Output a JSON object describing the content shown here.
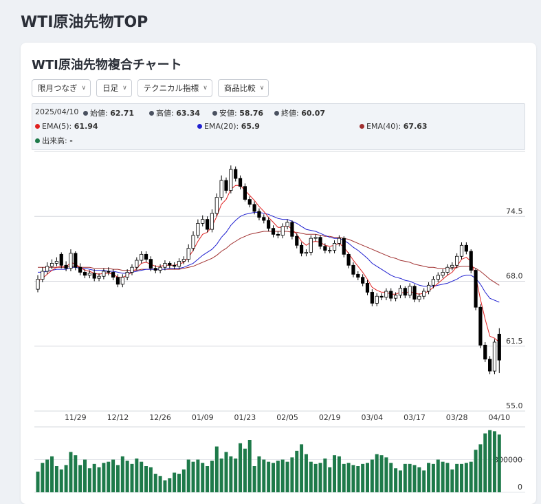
{
  "page": {
    "title": "WTI原油先物TOP"
  },
  "card": {
    "title": "WTI原油先物複合チャート"
  },
  "controls": [
    {
      "label": "限月つなぎ"
    },
    {
      "label": "日足"
    },
    {
      "label": "テクニカル指標"
    },
    {
      "label": "商品比較"
    }
  ],
  "info": {
    "date": "2025/04/10",
    "open_label": "始値:",
    "open": "62.71",
    "high_label": "高値:",
    "high": "63.34",
    "low_label": "安値:",
    "low": "58.76",
    "close_label": "終値:",
    "close": "60.07",
    "ema5_label": "EMA(5):",
    "ema5": "61.94",
    "ema20_label": "EMA(20):",
    "ema20": "65.9",
    "ema40_label": "EMA(40):",
    "ema40": "67.63",
    "volume_label": "出来高:",
    "volume": "-"
  },
  "colors": {
    "up": "#ffffff",
    "down": "#000000",
    "ema5": "#e02020",
    "ema20": "#2020d0",
    "ema40": "#a03030",
    "volume": "#1e7a4a",
    "ohlc_dot": "#4a5160"
  },
  "chart_data": {
    "type": "candlestick",
    "price_axis": {
      "ticks": [
        55.0,
        61.5,
        68.0,
        74.5
      ],
      "tick_labels": [
        "55.0",
        "61.5",
        "68.0",
        "74.5"
      ],
      "range": [
        55.0,
        81.0
      ]
    },
    "volume_axis": {
      "ticks": [
        0,
        300000
      ],
      "tick_labels": [
        "0",
        "300000"
      ],
      "range": [
        0,
        600000
      ]
    },
    "x_tick_labels": [
      "11/29",
      "12/12",
      "12/26",
      "01/09",
      "01/23",
      "02/05",
      "02/19",
      "03/04",
      "03/17",
      "03/28",
      "04/10"
    ],
    "x_tick_index": [
      8,
      17,
      26,
      35,
      44,
      53,
      62,
      71,
      80,
      89,
      98
    ],
    "series": [
      {
        "name": "EMA(5)"
      },
      {
        "name": "EMA(20)"
      },
      {
        "name": "EMA(40)"
      }
    ],
    "closes": [
      68.2,
      69.0,
      69.5,
      69.8,
      70.0,
      69.6,
      69.3,
      70.8,
      69.4,
      68.9,
      68.6,
      68.8,
      68.3,
      68.5,
      69.0,
      68.9,
      68.4,
      67.7,
      68.4,
      68.9,
      69.4,
      70.1,
      70.7,
      70.2,
      69.3,
      69.1,
      69.4,
      69.8,
      69.6,
      69.5,
      70.0,
      70.2,
      71.3,
      72.6,
      73.8,
      74.2,
      73.2,
      74.8,
      76.4,
      78.1,
      77.1,
      79.2,
      78.3,
      77.5,
      76.2,
      75.7,
      75.0,
      74.4,
      74.1,
      73.3,
      72.7,
      72.6,
      73.5,
      73.9,
      72.5,
      71.6,
      70.8,
      70.9,
      72.3,
      72.4,
      71.5,
      71.1,
      71.1,
      71.8,
      72.3,
      70.7,
      69.6,
      68.7,
      68.4,
      67.8,
      66.9,
      65.8,
      66.5,
      66.4,
      67.0,
      66.3,
      66.6,
      67.3,
      66.6,
      67.5,
      66.2,
      66.5,
      67.0,
      67.6,
      68.2,
      68.6,
      68.9,
      69.4,
      69.6,
      70.5,
      71.6,
      71.0,
      69.1,
      65.4,
      61.6,
      60.2,
      59.0,
      61.9,
      60.1
    ],
    "opens": [
      67.2,
      68.2,
      69.0,
      69.5,
      69.8,
      70.7,
      69.6,
      69.3,
      70.8,
      69.4,
      68.9,
      68.6,
      68.8,
      68.3,
      68.5,
      69.0,
      68.9,
      68.4,
      67.7,
      68.4,
      68.9,
      69.4,
      70.1,
      70.7,
      70.2,
      69.3,
      69.1,
      69.4,
      69.8,
      69.6,
      69.5,
      70.0,
      70.2,
      71.3,
      72.6,
      73.8,
      74.2,
      73.2,
      74.8,
      76.4,
      78.1,
      77.1,
      79.2,
      78.3,
      77.5,
      76.2,
      75.7,
      75.0,
      74.4,
      74.1,
      73.3,
      72.7,
      72.6,
      73.5,
      73.9,
      72.5,
      71.6,
      70.8,
      70.9,
      72.3,
      72.4,
      71.5,
      71.1,
      71.1,
      71.8,
      72.3,
      70.7,
      69.6,
      68.7,
      68.4,
      67.8,
      66.9,
      65.8,
      66.5,
      66.4,
      67.0,
      66.3,
      66.6,
      67.3,
      66.6,
      67.5,
      66.2,
      66.5,
      67.0,
      67.6,
      68.2,
      68.6,
      68.9,
      69.4,
      69.6,
      70.5,
      71.6,
      71.0,
      69.1,
      65.4,
      61.6,
      60.2,
      59.0,
      62.7
    ],
    "highs": [
      68.6,
      69.4,
      69.9,
      70.2,
      70.4,
      70.9,
      70.0,
      71.2,
      71.0,
      69.8,
      69.2,
      69.1,
      69.2,
      68.8,
      69.3,
      69.4,
      69.2,
      68.7,
      68.7,
      69.2,
      69.7,
      70.4,
      71.0,
      71.0,
      70.5,
      69.6,
      69.7,
      70.1,
      70.0,
      69.9,
      70.3,
      70.5,
      71.7,
      73.0,
      74.2,
      74.6,
      74.5,
      75.2,
      76.8,
      78.6,
      78.4,
      79.6,
      79.5,
      78.6,
      77.8,
      76.5,
      76.0,
      75.3,
      74.7,
      74.4,
      73.6,
      73.0,
      73.8,
      74.2,
      74.1,
      72.8,
      71.9,
      71.2,
      72.6,
      72.7,
      72.6,
      71.8,
      71.4,
      72.1,
      72.6,
      72.5,
      70.9,
      69.9,
      69.0,
      68.7,
      68.1,
      67.2,
      66.8,
      66.8,
      67.3,
      67.3,
      66.9,
      67.6,
      67.5,
      67.8,
      67.7,
      66.8,
      67.3,
      67.9,
      68.5,
      68.9,
      69.2,
      69.7,
      69.9,
      70.8,
      71.9,
      71.9,
      71.2,
      69.3,
      65.7,
      61.9,
      60.5,
      62.2,
      63.3
    ],
    "lows": [
      66.9,
      67.9,
      68.7,
      69.2,
      69.5,
      69.3,
      69.0,
      69.0,
      69.1,
      68.6,
      68.3,
      68.3,
      68.0,
      68.0,
      68.2,
      68.6,
      68.1,
      67.4,
      67.4,
      68.1,
      68.6,
      69.1,
      69.8,
      69.9,
      69.0,
      68.8,
      68.8,
      69.1,
      69.3,
      69.2,
      69.2,
      69.7,
      69.9,
      71.0,
      72.3,
      73.5,
      72.9,
      72.9,
      74.5,
      76.1,
      76.8,
      76.8,
      78.0,
      77.2,
      76.0,
      75.4,
      74.7,
      74.1,
      73.8,
      73.0,
      72.4,
      72.3,
      72.3,
      73.2,
      72.2,
      71.3,
      70.5,
      70.5,
      70.6,
      72.0,
      71.2,
      70.8,
      70.8,
      70.8,
      71.5,
      70.4,
      69.3,
      68.4,
      68.1,
      67.5,
      66.6,
      65.5,
      65.5,
      66.1,
      66.1,
      66.0,
      66.0,
      66.3,
      66.3,
      66.3,
      65.9,
      65.9,
      66.2,
      66.7,
      67.3,
      67.9,
      68.3,
      68.6,
      69.1,
      69.3,
      70.2,
      70.7,
      68.8,
      65.1,
      61.3,
      59.9,
      58.7,
      58.7,
      58.8
    ],
    "ema5": [
      68.0,
      68.3,
      68.7,
      69.1,
      69.4,
      69.5,
      69.4,
      69.9,
      69.7,
      69.4,
      69.1,
      69.0,
      68.8,
      68.7,
      68.8,
      68.8,
      68.7,
      68.4,
      68.4,
      68.6,
      68.9,
      69.3,
      69.8,
      69.9,
      69.7,
      69.5,
      69.5,
      69.6,
      69.6,
      69.6,
      69.7,
      69.9,
      70.4,
      71.1,
      72.0,
      72.7,
      72.9,
      73.5,
      74.5,
      75.7,
      76.2,
      77.2,
      77.6,
      77.6,
      77.1,
      76.6,
      76.1,
      75.5,
      75.0,
      74.4,
      73.9,
      73.4,
      73.4,
      73.6,
      73.2,
      72.7,
      72.0,
      71.6,
      71.9,
      72.0,
      71.9,
      71.6,
      71.5,
      71.6,
      71.8,
      71.4,
      70.8,
      70.1,
      69.5,
      68.9,
      68.2,
      67.4,
      67.1,
      66.9,
      66.9,
      66.7,
      66.7,
      66.9,
      66.8,
      67.0,
      66.8,
      66.7,
      66.8,
      67.0,
      67.4,
      67.8,
      68.2,
      68.6,
      68.9,
      69.5,
      70.2,
      70.4,
      70.0,
      68.5,
      66.2,
      64.2,
      62.5,
      62.3,
      61.9
    ],
    "ema20": [
      68.9,
      68.9,
      69.0,
      69.1,
      69.2,
      69.2,
      69.2,
      69.4,
      69.4,
      69.3,
      69.3,
      69.2,
      69.1,
      69.1,
      69.1,
      69.0,
      69.0,
      68.9,
      68.8,
      68.8,
      68.9,
      69.0,
      69.1,
      69.2,
      69.2,
      69.2,
      69.2,
      69.2,
      69.3,
      69.3,
      69.3,
      69.4,
      69.6,
      69.8,
      70.2,
      70.6,
      70.9,
      71.2,
      71.7,
      72.4,
      72.9,
      73.6,
      74.1,
      74.5,
      74.7,
      74.8,
      74.9,
      74.9,
      74.8,
      74.7,
      74.5,
      74.3,
      74.2,
      74.2,
      74.0,
      73.8,
      73.5,
      73.2,
      73.1,
      73.0,
      72.8,
      72.6,
      72.4,
      72.3,
      72.3,
      72.1,
      71.8,
      71.4,
      71.1,
      70.7,
      70.3,
      69.8,
      69.5,
      69.2,
      68.9,
      68.6,
      68.4,
      68.3,
      68.1,
      68.0,
      67.8,
      67.6,
      67.5,
      67.5,
      67.5,
      67.6,
      67.7,
      67.8,
      68.0,
      68.2,
      68.5,
      68.6,
      68.6,
      68.3,
      67.7,
      66.9,
      66.3,
      66.1,
      65.9
    ],
    "ema40": [
      69.4,
      69.4,
      69.4,
      69.4,
      69.4,
      69.4,
      69.4,
      69.5,
      69.5,
      69.4,
      69.4,
      69.4,
      69.3,
      69.3,
      69.3,
      69.3,
      69.2,
      69.2,
      69.1,
      69.1,
      69.1,
      69.1,
      69.2,
      69.2,
      69.2,
      69.2,
      69.2,
      69.2,
      69.2,
      69.2,
      69.2,
      69.3,
      69.4,
      69.5,
      69.7,
      69.9,
      70.1,
      70.3,
      70.6,
      71.0,
      71.3,
      71.7,
      72.0,
      72.3,
      72.5,
      72.7,
      72.8,
      72.9,
      73.0,
      73.0,
      73.0,
      73.0,
      73.0,
      73.0,
      72.9,
      72.9,
      72.8,
      72.7,
      72.7,
      72.7,
      72.6,
      72.5,
      72.5,
      72.4,
      72.4,
      72.3,
      72.2,
      72.0,
      71.8,
      71.6,
      71.4,
      71.2,
      71.0,
      70.8,
      70.6,
      70.4,
      70.3,
      70.1,
      70.0,
      69.9,
      69.7,
      69.6,
      69.5,
      69.4,
      69.4,
      69.3,
      69.3,
      69.3,
      69.3,
      69.4,
      69.5,
      69.5,
      69.5,
      69.3,
      69.0,
      68.6,
      68.2,
      67.9,
      67.6
    ],
    "volumes": [
      190000,
      270000,
      300000,
      330000,
      240000,
      210000,
      250000,
      370000,
      340000,
      250000,
      300000,
      220000,
      260000,
      230000,
      270000,
      280000,
      300000,
      250000,
      330000,
      290000,
      260000,
      310000,
      280000,
      240000,
      230000,
      170000,
      150000,
      110000,
      130000,
      180000,
      170000,
      210000,
      300000,
      280000,
      300000,
      270000,
      240000,
      290000,
      420000,
      310000,
      370000,
      330000,
      310000,
      450000,
      400000,
      480000,
      240000,
      330000,
      300000,
      280000,
      270000,
      290000,
      300000,
      280000,
      320000,
      380000,
      440000,
      350000,
      280000,
      260000,
      270000,
      310000,
      230000,
      340000,
      330000,
      260000,
      270000,
      250000,
      240000,
      260000,
      270000,
      300000,
      350000,
      340000,
      320000,
      270000,
      220000,
      200000,
      260000,
      260000,
      250000,
      230000,
      200000,
      270000,
      260000,
      300000,
      280000,
      270000,
      210000,
      260000,
      260000,
      270000,
      280000,
      390000,
      440000,
      540000,
      570000,
      560000,
      530000
    ]
  }
}
